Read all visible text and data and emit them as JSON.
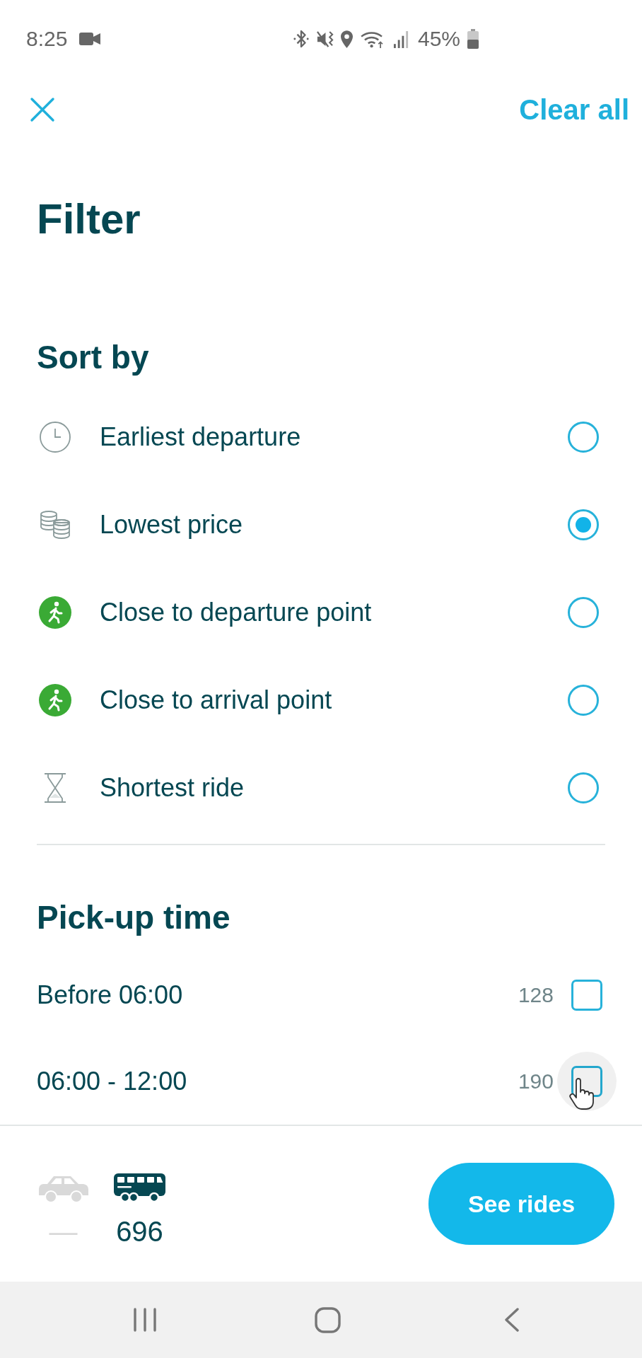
{
  "status_bar": {
    "time": "8:25",
    "battery": "45%"
  },
  "header": {
    "clear_all": "Clear all"
  },
  "title": "Filter",
  "sort": {
    "heading": "Sort by",
    "options": [
      {
        "kind": "clock",
        "label": "Earliest departure",
        "selected": false
      },
      {
        "kind": "coins",
        "label": "Lowest price",
        "selected": true
      },
      {
        "kind": "walk",
        "label": "Close to departure point",
        "selected": false
      },
      {
        "kind": "walk",
        "label": "Close to arrival point",
        "selected": false
      },
      {
        "kind": "hourglass",
        "label": "Shortest ride",
        "selected": false
      }
    ]
  },
  "pickup": {
    "heading": "Pick-up time",
    "options": [
      {
        "label": "Before 06:00",
        "count": "128",
        "checked": false,
        "pressed": false
      },
      {
        "label": "06:00 - 12:00",
        "count": "190",
        "checked": false,
        "pressed": true
      }
    ]
  },
  "footer": {
    "modes": [
      {
        "kind": "car",
        "count": "—",
        "disabled": true
      },
      {
        "kind": "bus",
        "count": "696",
        "disabled": false
      }
    ],
    "button": "See rides"
  }
}
